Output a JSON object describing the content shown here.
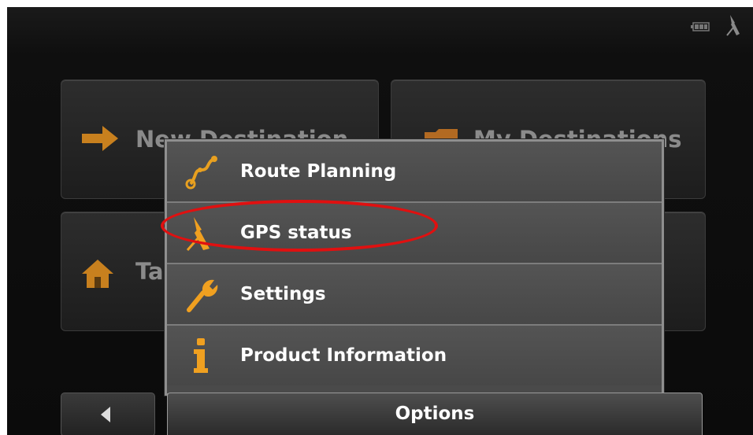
{
  "tiles": {
    "new_destination": "New Destination",
    "my_destinations": "My Destinations",
    "take_me_home": "Take Me Home"
  },
  "menu": {
    "items": [
      {
        "label": "Route Planning",
        "icon": "route-icon"
      },
      {
        "label": "GPS status",
        "icon": "gps-status-icon"
      },
      {
        "label": "Settings",
        "icon": "wrench-icon"
      },
      {
        "label": "Product Information",
        "icon": "info-icon"
      }
    ]
  },
  "bottom": {
    "options_label": "Options"
  },
  "colors": {
    "highlight": "#e01010",
    "accent": "#f0a020"
  }
}
